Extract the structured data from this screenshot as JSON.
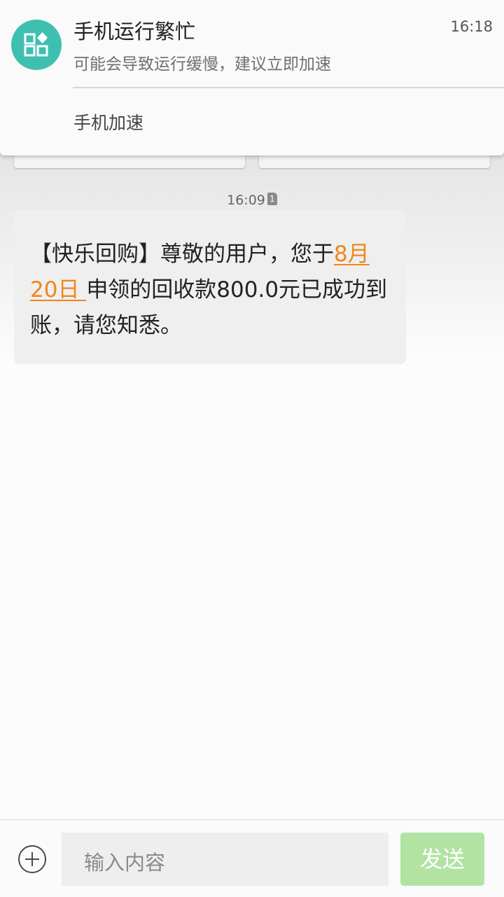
{
  "notification": {
    "icon": "apps-grid-icon",
    "icon_color": "#3fbfb0",
    "title": "手机运行繁忙",
    "time": "16:18",
    "body": "可能会导致运行缓慢，建议立即加速",
    "action": "手机加速"
  },
  "conversation": {
    "timestamp": "16:09",
    "sim_slot": "1",
    "message": {
      "prefix": "【快乐回购】尊敬的用户，您于",
      "link_text": "8月20日 ",
      "suffix": "申领的回收款800.0元已成功到账，请您知悉。",
      "link_color": "#f0861a"
    }
  },
  "composer": {
    "add_icon": "plus-circle-icon",
    "placeholder": "输入内容",
    "send_label": "发送",
    "send_color": "#b2e3a3"
  }
}
